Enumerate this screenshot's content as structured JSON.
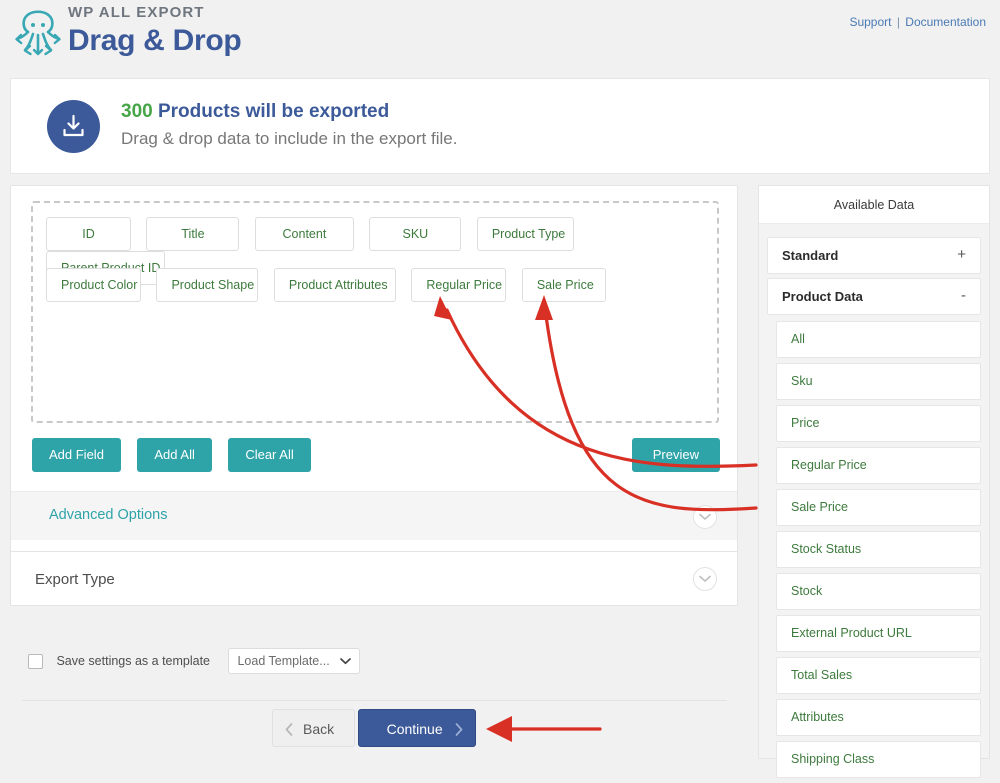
{
  "header": {
    "logo_icon": "octopus-icon",
    "brand_sub": "WP ALL EXPORT",
    "brand_title": "Drag & Drop",
    "support_link": "Support",
    "separator": "|",
    "documentation_link": "Documentation"
  },
  "notice": {
    "icon": "download-icon",
    "count": "300",
    "line1_rest": " Products will be exported",
    "line2": "Drag & drop data to include in the export file.",
    "count_color": "#46a546",
    "text_color": "#3c5a99"
  },
  "dropzone": {
    "row1": [
      "ID",
      "Title",
      "Content",
      "SKU",
      "Product Type",
      "Parent Product ID"
    ],
    "row2": [
      "Product Color",
      "Product Shape",
      "Product Attributes",
      "Regular Price",
      "Sale Price"
    ]
  },
  "buttons": {
    "add_field": "Add Field",
    "add_all": "Add All",
    "clear_all": "Clear All",
    "preview": "Preview",
    "accent_color": "#2ea3a8"
  },
  "sections": {
    "advanced_options": "Advanced Options",
    "export_type": "Export Type",
    "toggle_icon": "chevron-down-icon"
  },
  "template": {
    "checkbox_label": "Save settings as a template",
    "checked": false,
    "select_value": "Load Template...",
    "select_icon": "chevron-down-icon"
  },
  "nav": {
    "back": "Back",
    "back_icon": "chevron-left-icon",
    "continue": "Continue",
    "continue_icon": "chevron-right-icon",
    "continue_color": "#3c5a99"
  },
  "sidebar": {
    "title": "Available Data",
    "sections": [
      {
        "label": "Standard",
        "sign": "+",
        "expanded": false
      },
      {
        "label": "Product Data",
        "sign": "-",
        "expanded": true
      }
    ],
    "items": [
      "All",
      "Sku",
      "Price",
      "Regular Price",
      "Sale Price",
      "Stock Status",
      "Stock",
      "External Product URL",
      "Total Sales",
      "Attributes",
      "Shipping Class"
    ]
  },
  "annotations": {
    "color": "#d93025",
    "arrow_regular_price": "curved-arrow-icon",
    "arrow_sale_price": "curved-arrow-icon",
    "arrow_continue": "straight-arrow-icon"
  }
}
